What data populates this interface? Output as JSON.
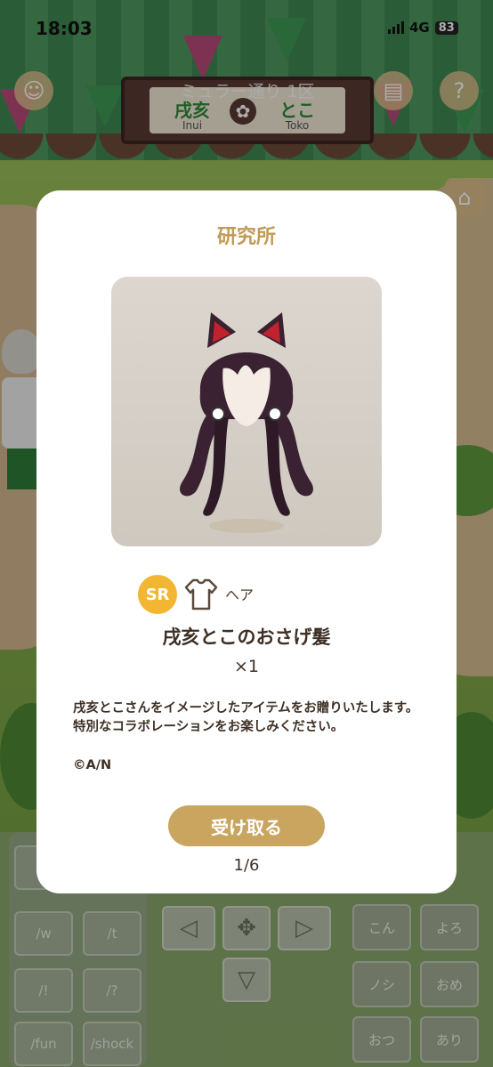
{
  "status_bar": {
    "time": "18:03",
    "network": "4G",
    "battery": "83"
  },
  "top_hud": {
    "area_name": "ミュラー通り 1区",
    "sign_left": {
      "kanji": "戌亥",
      "romaji": "Inui"
    },
    "sign_right": {
      "kanji": "とこ",
      "romaji": "Toko"
    },
    "help": "?"
  },
  "modal": {
    "title": "研究所",
    "rarity": "SR",
    "category": "ヘア",
    "item_name": "戌亥とこのおさげ髪",
    "quantity": "×1",
    "description": "戌亥とこさんをイメージしたアイテムをお贈りいたします。特別なコラボレーションをお楽しみください。",
    "copyright": "©A/N",
    "receive_label": "受け取る",
    "pager": "1/6"
  },
  "chat_keys": [
    "/p",
    "/w",
    "/t",
    "/!",
    "/?",
    "/fun",
    "/shock"
  ],
  "reaction_keys": [
    "こん",
    "よろ",
    "ノシ",
    "おめ",
    "おつ",
    "あり"
  ],
  "colors": {
    "accent": "#c9a55f",
    "title": "#c19a55",
    "rarity": "#f2b632"
  }
}
